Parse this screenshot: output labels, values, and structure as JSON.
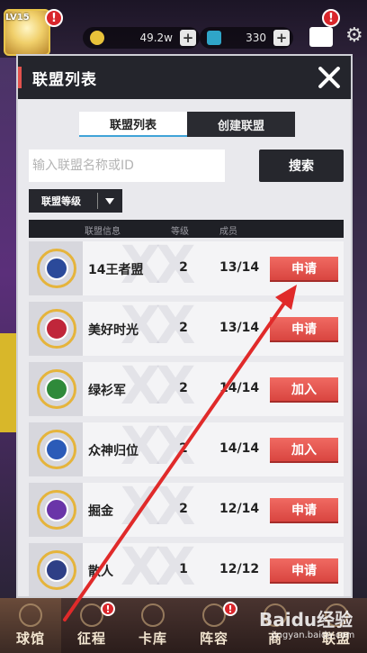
{
  "hud": {
    "level": "LV15",
    "gold": "49.2w",
    "diamonds": "330",
    "alert_mark": "!"
  },
  "modal": {
    "title": "联盟列表",
    "tabs": [
      {
        "label": "联盟列表",
        "active": true
      },
      {
        "label": "创建联盟",
        "active": false
      }
    ],
    "search": {
      "placeholder": "输入联盟名称或ID",
      "value": "",
      "button_label": "搜索"
    },
    "filter_label": "联盟等级",
    "columns": [
      "联盟信息",
      "等级",
      "成员"
    ],
    "rows": [
      {
        "name": "14王者盟",
        "level": "2",
        "members": "13/14",
        "action": "申请",
        "emblem_color": "#2b4a9a"
      },
      {
        "name": "美好时光",
        "level": "2",
        "members": "13/14",
        "action": "申请",
        "emblem_color": "#c0263a"
      },
      {
        "name": "绿衫军",
        "level": "2",
        "members": "14/14",
        "action": "加入",
        "emblem_color": "#2f8a3a"
      },
      {
        "name": "众神归位",
        "level": "2",
        "members": "14/14",
        "action": "加入",
        "emblem_color": "#2b5bb8"
      },
      {
        "name": "掘金",
        "level": "2",
        "members": "12/14",
        "action": "申请",
        "emblem_color": "#6a35a8"
      },
      {
        "name": "散人",
        "level": "1",
        "members": "12/12",
        "action": "申请",
        "emblem_color": "#2e3f86"
      }
    ]
  },
  "bottom_nav": [
    {
      "label": "球馆",
      "icon": "arena-icon"
    },
    {
      "label": "征程",
      "icon": "journey-icon"
    },
    {
      "label": "卡库",
      "icon": "cards-icon"
    },
    {
      "label": "阵容",
      "icon": "lineup-icon"
    },
    {
      "label": "商",
      "icon": "shop-icon"
    },
    {
      "label": "联盟",
      "icon": "alliance-icon"
    }
  ],
  "watermark": {
    "brand": "Baidu经验",
    "url": "jingyan.baidu.com"
  },
  "colors": {
    "header_bg": "#24252c",
    "accent_red": "#e2524d",
    "action_button": "#d94540",
    "tab_underline": "#3fa3d8",
    "annotation_arrow": "#e02a2a"
  }
}
